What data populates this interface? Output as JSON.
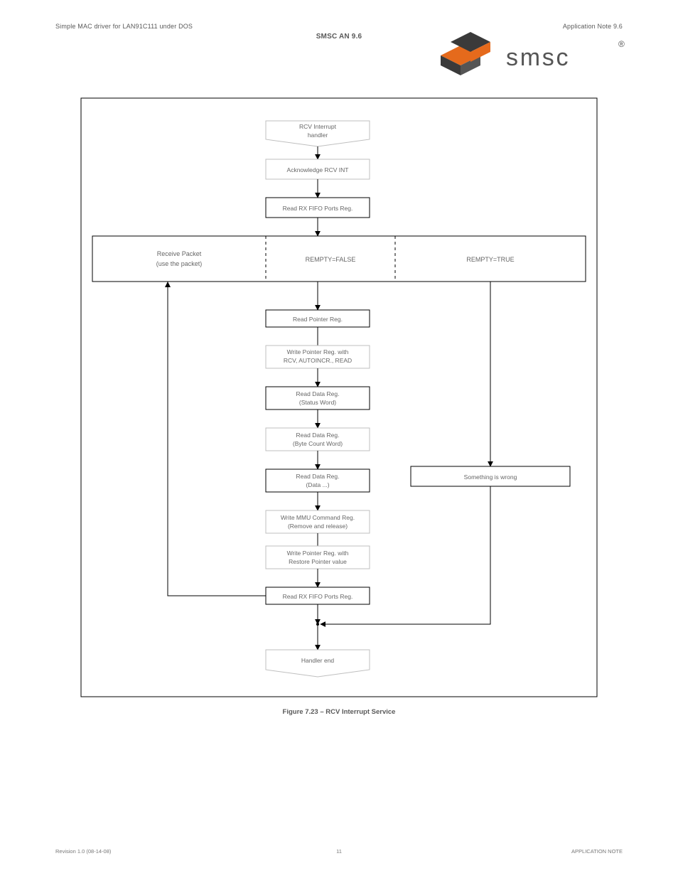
{
  "header": {
    "left": "Simple MAC driver for LAN91C111 under DOS",
    "right": "Application Note 9.6",
    "title": "SMSC AN 9.6"
  },
  "logo": {
    "text": "smsc",
    "reg": "®"
  },
  "figure": {
    "caption": "Figure 7.23 – RCV Interrupt Service",
    "start": {
      "l1": "RCV Interrupt",
      "l2": "handler"
    },
    "step1": "Acknowledge RCV INT",
    "step2": "Read RX FIFO Ports Reg.",
    "cols": {
      "left": {
        "l1": "Receive Packet",
        "l2": "(use the packet)"
      },
      "mid": "REMPTY=FALSE",
      "right": "REMPTY=TRUE"
    },
    "mid": [
      {
        "type": "S",
        "l1": "Read Pointer Reg."
      },
      {
        "type": "L",
        "l1": "Write Pointer Reg. with",
        "l2": "RCV, AUTOINCR., READ"
      },
      {
        "type": "S",
        "l1": "Read Data Reg.",
        "l2": "(Status Word)"
      },
      {
        "type": "L",
        "l1": "Read Data Reg.",
        "l2": "(Byte Count Word)"
      },
      {
        "type": "S",
        "l1": "Read Data Reg.",
        "l2": "(Data ...)"
      },
      {
        "type": "L",
        "l1": "Write MMU Command Reg.",
        "l2": "(Remove and release)"
      },
      {
        "type": "L",
        "l1": "Write Pointer Reg. with",
        "l2": "Restore Pointer value"
      },
      {
        "type": "S",
        "l1": "Read RX FIFO Ports Reg."
      }
    ],
    "rightBox": "Something is wrong",
    "end": "Handler end"
  },
  "footer": {
    "left": "Revision 1.0 (08-14-08)",
    "center": "11",
    "right": "APPLICATION NOTE"
  }
}
